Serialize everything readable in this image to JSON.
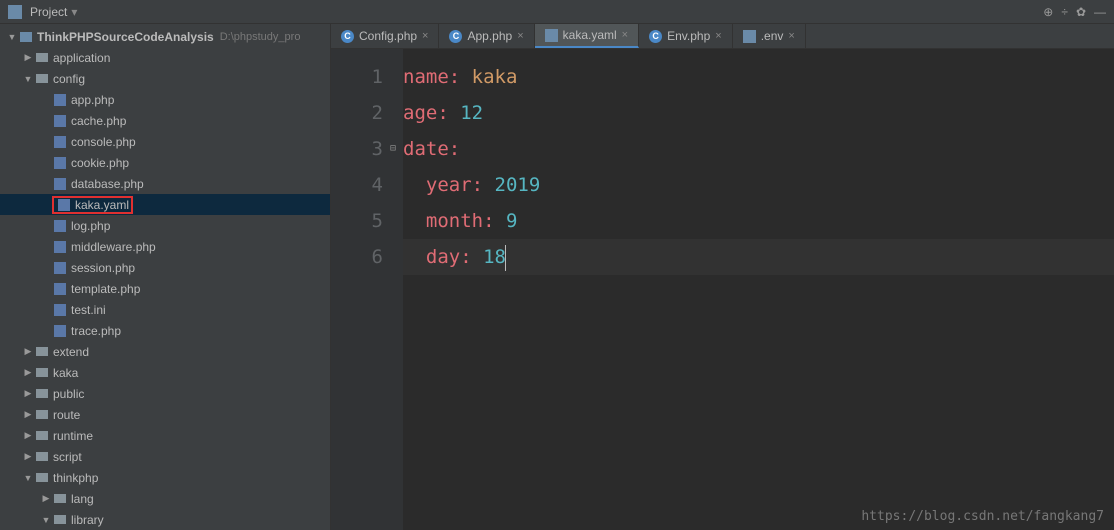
{
  "toolbar": {
    "project_label": "Project",
    "icons": [
      "collapse-icon",
      "divide-icon",
      "gear-icon",
      "hide-icon"
    ]
  },
  "project_root": {
    "name": "ThinkPHPSourceCodeAnalysis",
    "path": "D:\\phpstudy_pro"
  },
  "tree": [
    {
      "level": 1,
      "type": "folder",
      "arrow": "right",
      "label": "application"
    },
    {
      "level": 1,
      "type": "folder",
      "arrow": "down",
      "label": "config"
    },
    {
      "level": 2,
      "type": "php",
      "label": "app.php"
    },
    {
      "level": 2,
      "type": "php",
      "label": "cache.php"
    },
    {
      "level": 2,
      "type": "php",
      "label": "console.php"
    },
    {
      "level": 2,
      "type": "php",
      "label": "cookie.php"
    },
    {
      "level": 2,
      "type": "php",
      "label": "database.php"
    },
    {
      "level": 2,
      "type": "yaml",
      "label": "kaka.yaml",
      "selected": true,
      "boxed": true
    },
    {
      "level": 2,
      "type": "php",
      "label": "log.php"
    },
    {
      "level": 2,
      "type": "php",
      "label": "middleware.php"
    },
    {
      "level": 2,
      "type": "php",
      "label": "session.php"
    },
    {
      "level": 2,
      "type": "php",
      "label": "template.php"
    },
    {
      "level": 2,
      "type": "ini",
      "label": "test.ini"
    },
    {
      "level": 2,
      "type": "php",
      "label": "trace.php"
    },
    {
      "level": 1,
      "type": "folder",
      "arrow": "right",
      "label": "extend"
    },
    {
      "level": 1,
      "type": "folder",
      "arrow": "right",
      "label": "kaka"
    },
    {
      "level": 1,
      "type": "folder",
      "arrow": "right",
      "label": "public"
    },
    {
      "level": 1,
      "type": "folder",
      "arrow": "right",
      "label": "route"
    },
    {
      "level": 1,
      "type": "folder",
      "arrow": "right",
      "label": "runtime"
    },
    {
      "level": 1,
      "type": "folder",
      "arrow": "right",
      "label": "script"
    },
    {
      "level": 1,
      "type": "folder",
      "arrow": "down",
      "label": "thinkphp"
    },
    {
      "level": 2,
      "type": "folder",
      "arrow": "right",
      "label": "lang"
    },
    {
      "level": 2,
      "type": "folder",
      "arrow": "down",
      "label": "library"
    }
  ],
  "tabs": [
    {
      "icon": "c",
      "label": "Config.php"
    },
    {
      "icon": "c",
      "label": "App.php"
    },
    {
      "icon": "yaml",
      "label": "kaka.yaml",
      "active": true
    },
    {
      "icon": "c",
      "label": "Env.php"
    },
    {
      "icon": "file",
      "label": ".env"
    }
  ],
  "code": {
    "lines": [
      {
        "num": 1,
        "segments": [
          [
            "k",
            "name:"
          ],
          [
            "p",
            " "
          ],
          [
            "s",
            "kaka"
          ]
        ]
      },
      {
        "num": 2,
        "segments": [
          [
            "k",
            "age:"
          ],
          [
            "p",
            " "
          ],
          [
            "n",
            "12"
          ]
        ]
      },
      {
        "num": 3,
        "segments": [
          [
            "k",
            "date:"
          ]
        ],
        "fold": true
      },
      {
        "num": 4,
        "segments": [
          [
            "p",
            "  "
          ],
          [
            "k",
            "year:"
          ],
          [
            "p",
            " "
          ],
          [
            "n",
            "2019"
          ]
        ]
      },
      {
        "num": 5,
        "segments": [
          [
            "p",
            "  "
          ],
          [
            "k",
            "month:"
          ],
          [
            "p",
            " "
          ],
          [
            "n",
            "9"
          ]
        ]
      },
      {
        "num": 6,
        "segments": [
          [
            "p",
            "  "
          ],
          [
            "k",
            "day:"
          ],
          [
            "p",
            " "
          ],
          [
            "n",
            "18"
          ]
        ],
        "current": true,
        "cursor": true
      }
    ]
  },
  "watermark": "https://blog.csdn.net/fangkang7"
}
